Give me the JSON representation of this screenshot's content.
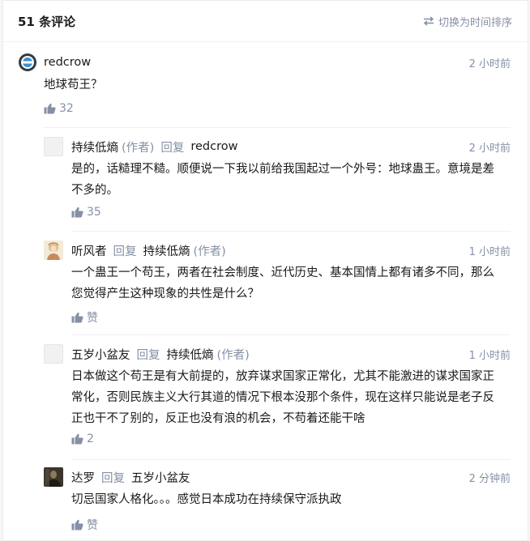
{
  "header": {
    "count_label": "51 条评论",
    "sort_label": "切换为时间排序",
    "sort_icon": "swap-icon"
  },
  "colors": {
    "muted": "#8590a6",
    "text": "#1a1a1a",
    "divider": "#f0f0f0"
  },
  "comments": [
    {
      "name": "redcrow",
      "author_tag": "",
      "reply_word": "",
      "reply_to": "",
      "reply_to_tag": "",
      "time": "2 小时前",
      "text": "地球苟王？",
      "likes": "32",
      "avatar": "redcrow-logo-avatar"
    },
    {
      "name": "持续低熵",
      "author_tag": "(作者)",
      "reply_word": "回复",
      "reply_to": "redcrow",
      "reply_to_tag": "",
      "time": "2 小时前",
      "text_lines": [
        "是的，话糙理不糙。顺便说一下我以前给我国起过一个外号：地球蛊王。意境是差",
        "不多的。"
      ],
      "likes": "35",
      "avatar": "blank-avatar"
    },
    {
      "name": "听风者",
      "author_tag": "",
      "reply_word": "回复",
      "reply_to": "持续低熵",
      "reply_to_tag": "(作者)",
      "time": "1 小时前",
      "text_lines": [
        "一个蛊王一个苟王，两者在社会制度、近代历史、基本国情上都有诸多不同，那么",
        "您觉得产生这种现象的共性是什么？"
      ],
      "likes": "赞",
      "avatar": "painting-avatar"
    },
    {
      "name": "五岁小盆友",
      "author_tag": "",
      "reply_word": "回复",
      "reply_to": "持续低熵",
      "reply_to_tag": "(作者)",
      "time": "1 小时前",
      "text_lines": [
        "日本做这个苟王是有大前提的，放弃谋求国家正常化，尤其不能激进的谋求国家正",
        "常化，否则民族主义大行其道的情况下根本没那个条件，现在这样只能说是老子反",
        "正也干不了别的，反正也没有浪的机会，不苟着还能干啥"
      ],
      "likes": "2",
      "avatar": "blank-avatar"
    },
    {
      "name": "达罗",
      "author_tag": "",
      "reply_word": "回复",
      "reply_to": "五岁小盆友",
      "reply_to_tag": "",
      "time": "2 分钟前",
      "text": "切忌国家人格化。。。感觉日本成功在持续保守派执政",
      "likes": "赞",
      "avatar": "dark-portrait-avatar"
    }
  ]
}
